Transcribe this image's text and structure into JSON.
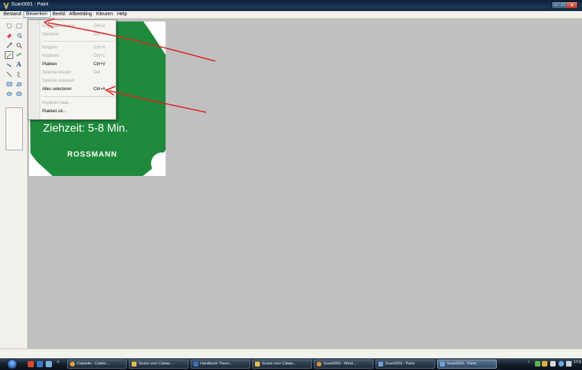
{
  "window": {
    "title": "Scan0001 - Paint"
  },
  "menubar": {
    "items": [
      "Bestand",
      "Bewerken",
      "Beeld",
      "Afbeelding",
      "Kleuren",
      "Help"
    ]
  },
  "edit_menu": {
    "items": [
      {
        "label": "Ongedaan maken",
        "shortcut": "Ctrl+Z",
        "enabled": false
      },
      {
        "label": "Opnieuw",
        "shortcut": "Ctrl+Y",
        "enabled": false
      },
      {
        "label": "Knippen",
        "shortcut": "Ctrl+X",
        "enabled": false
      },
      {
        "label": "Kopiëren",
        "shortcut": "Ctrl+C",
        "enabled": false
      },
      {
        "label": "Plakken",
        "shortcut": "Ctrl+V",
        "enabled": true
      },
      {
        "label": "Selectie wissen",
        "shortcut": "Del",
        "enabled": false
      },
      {
        "label": "Selectie omkeren",
        "shortcut": "",
        "enabled": false
      },
      {
        "label": "Alles selecteren",
        "shortcut": "Ctrl+A",
        "enabled": true
      },
      {
        "label": "Kopiëren naar...",
        "shortcut": "",
        "enabled": false
      },
      {
        "label": "Plakken uit...",
        "shortcut": "",
        "enabled": true
      }
    ]
  },
  "image": {
    "text": "Ziehzeit: 5-8 Min.",
    "brand": "ROSSMANN",
    "color": "#1f8a3c"
  },
  "taskbar": {
    "tasks": [
      {
        "label": "Catawiki - Catalo...",
        "icon": "chrome-icon",
        "color": "#e8a33a"
      },
      {
        "label": "Scans voor Cataw...",
        "icon": "folder-icon",
        "color": "#e6c04a"
      },
      {
        "label": "Handboek Theez...",
        "icon": "word-icon",
        "color": "#3c6fc4"
      },
      {
        "label": "Scans voor Cataw...",
        "icon": "folder-icon",
        "color": "#e6c04a"
      },
      {
        "label": "Scan0002 - Wind...",
        "icon": "photo-viewer-icon",
        "color": "#d98b3a"
      },
      {
        "label": "Scan0002 - Paint",
        "icon": "paint-icon",
        "color": "#6fa0d8"
      },
      {
        "label": "Scan0001 - Paint",
        "icon": "paint-icon",
        "color": "#6fa0d8",
        "active": true
      }
    ],
    "clock": "17:5"
  },
  "colors": {
    "annotation": "#e0201b"
  }
}
